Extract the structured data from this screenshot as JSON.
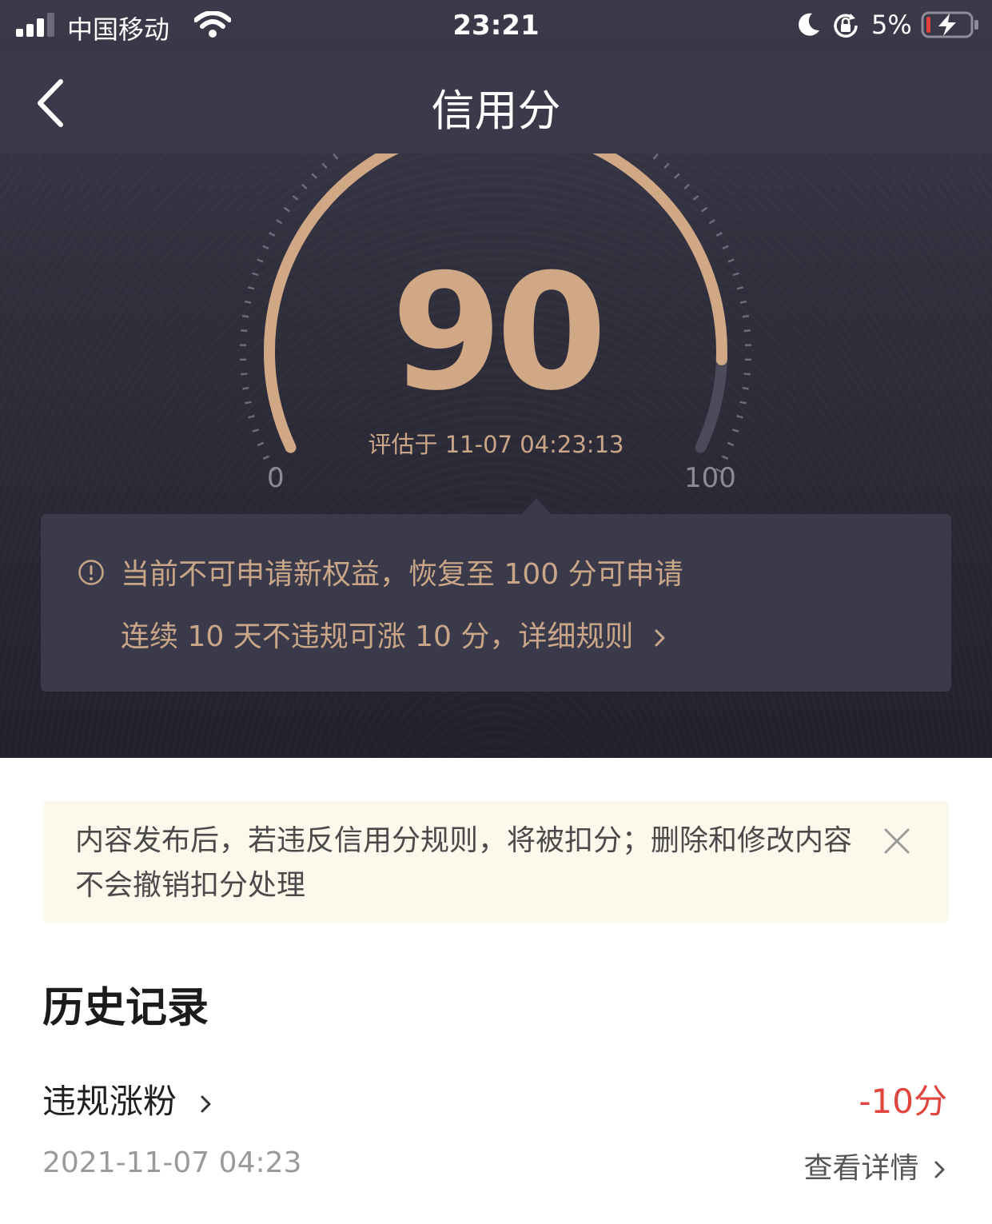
{
  "status_bar": {
    "carrier": "中国移动",
    "time": "23:21",
    "battery_percent": "5%"
  },
  "nav": {
    "title": "信用分"
  },
  "gauge": {
    "score": "90",
    "score_value": 90,
    "min_label": "0",
    "max_label": "100",
    "evaluated_at": "评估于 11-07 04:23:13"
  },
  "info": {
    "line1": "当前不可申请新权益，恢复至 100 分可申请",
    "line2": "连续 10 天不违规可涨 10 分，详细规则"
  },
  "notice": {
    "text": "内容发布后，若违反信用分规则，将被扣分；删除和修改内容不会撤销扣分处理"
  },
  "history": {
    "title": "历史记录",
    "records": [
      {
        "type": "违规涨粉",
        "score": "-10分",
        "time": "2021-11-07 04:23",
        "detail_label": "查看详情"
      }
    ]
  },
  "colors": {
    "gold": "#d1a886",
    "dark_bg": "#2f2e3b",
    "penalty_red": "#e0443c",
    "notice_bg": "#fdf8ec"
  }
}
